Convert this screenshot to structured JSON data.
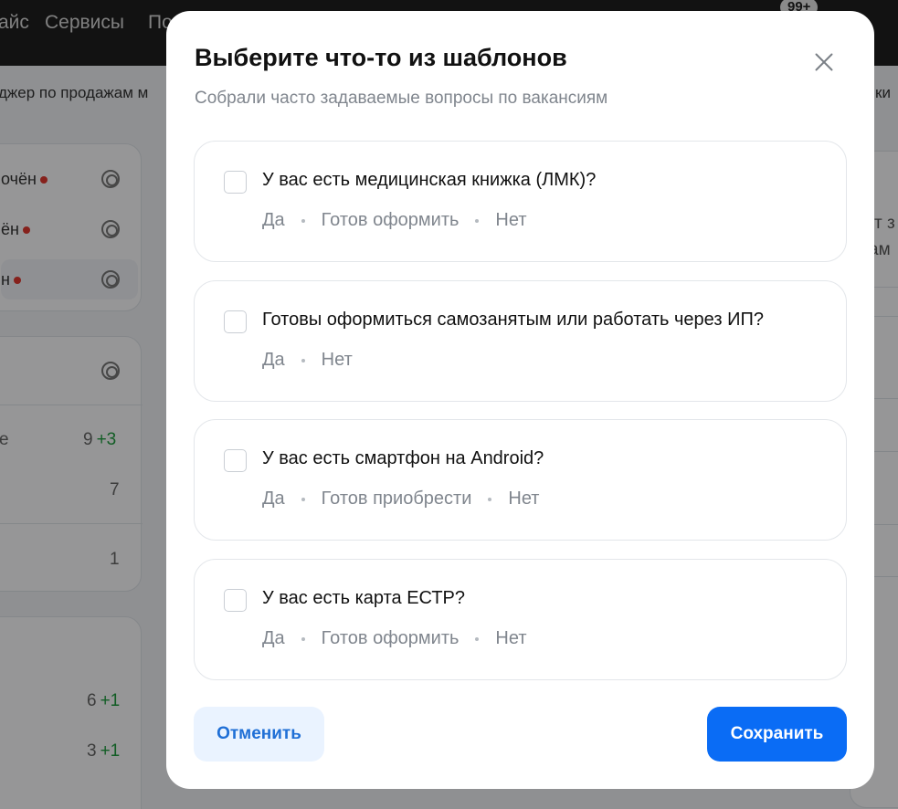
{
  "background": {
    "nav": [
      "айс",
      "Сервисы",
      "По"
    ],
    "nav_badge": "99+",
    "subtext_left": "джер по продажам м",
    "subtext_right": "ки",
    "status_rows": [
      {
        "label": "очён"
      },
      {
        "label": "ён"
      },
      {
        "label": "н"
      }
    ],
    "stats": [
      {
        "value": "9",
        "delta": "+3",
        "label": "е"
      },
      {
        "value": "7",
        "delta": ""
      },
      {
        "value": "1",
        "delta": ""
      },
      {
        "value": "6",
        "delta": "+1"
      },
      {
        "value": "3",
        "delta": "+1"
      }
    ],
    "right_fragment_1": "т з",
    "right_fragment_2": "ам"
  },
  "modal": {
    "title": "Выберите что-то из шаблонов",
    "subtitle": "Собрали часто задаваемые вопросы по вакансиям",
    "questions": [
      {
        "text": "У вас есть медицинская книжка (ЛМК)?",
        "answers": [
          "Да",
          "Готов оформить",
          "Нет"
        ],
        "checked": false
      },
      {
        "text": "Готовы оформиться самозанятым или работать через ИП?",
        "answers": [
          "Да",
          "Нет"
        ],
        "checked": false
      },
      {
        "text": "У вас есть смартфон на Android?",
        "answers": [
          "Да",
          "Готов приобрести",
          "Нет"
        ],
        "checked": false
      },
      {
        "text": "У вас есть карта ЕСТР?",
        "answers": [
          "Да",
          "Готов оформить",
          "Нет"
        ],
        "checked": false
      }
    ],
    "cancel_label": "Отменить",
    "save_label": "Сохранить"
  },
  "colors": {
    "accent": "#0a6cf5",
    "cancel_bg": "#eaf3ff",
    "positive_delta": "#1e9b3f",
    "status_dot": "#e0372f"
  }
}
